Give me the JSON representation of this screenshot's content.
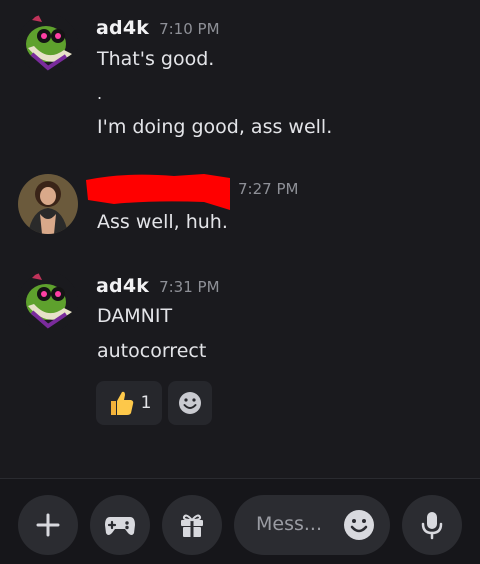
{
  "messages": [
    {
      "username": "ad4k",
      "time": "7:10 PM",
      "lines": [
        "That's good.",
        ".",
        "I'm doing good, ass well."
      ]
    },
    {
      "username": "",
      "time": "7:27 PM",
      "lines": [
        "Ass well, huh."
      ]
    },
    {
      "username": "ad4k",
      "time": "7:31 PM",
      "lines": [
        "DAMNIT",
        "autocorrect"
      ],
      "reactions": [
        {
          "emoji": "thumbs-up",
          "count": "1"
        }
      ]
    }
  ],
  "composer": {
    "placeholder": "Mess..."
  },
  "colors": {
    "background": "#1a1a1e",
    "redaction": "#ff0000",
    "avatar_green": "#5ea12d"
  }
}
